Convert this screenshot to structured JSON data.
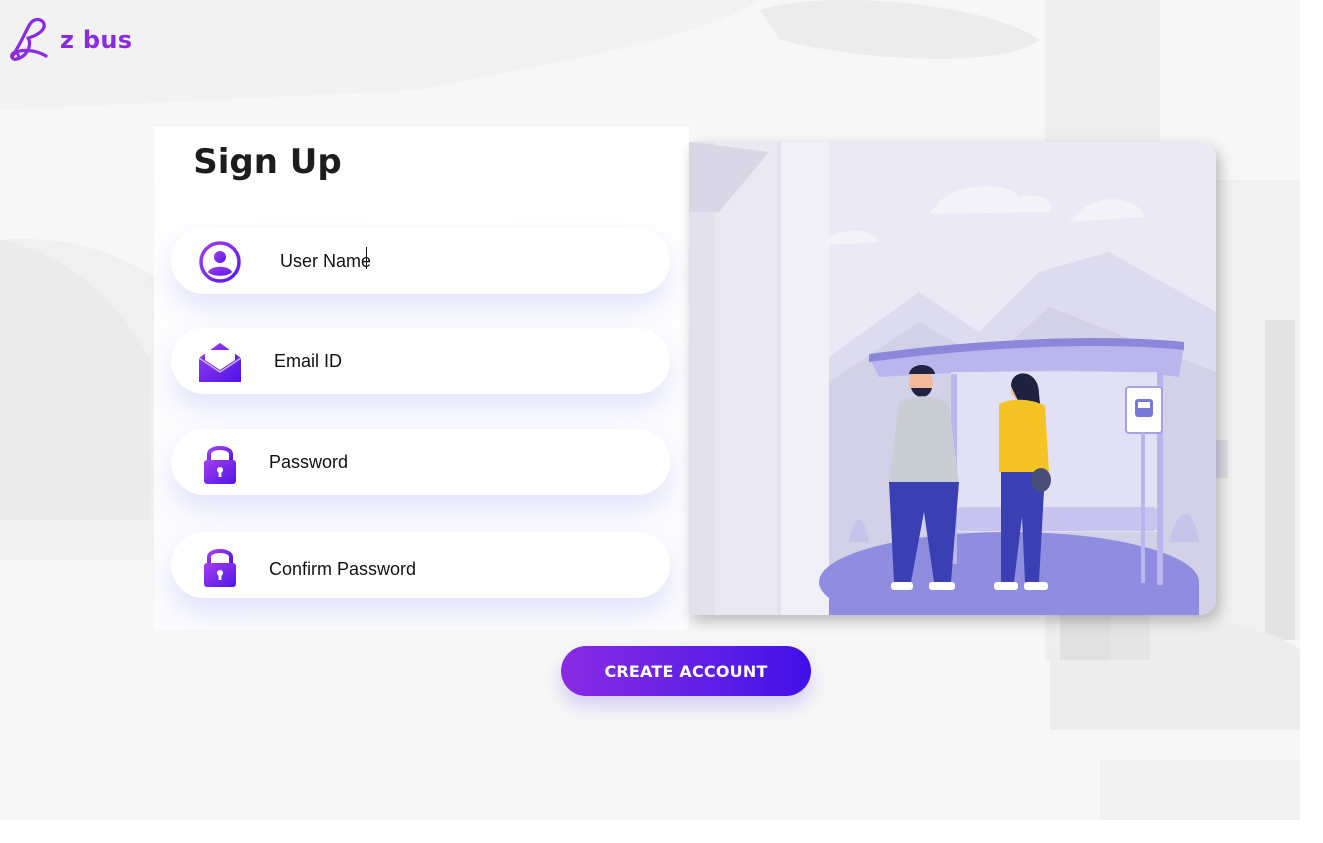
{
  "brand": {
    "name": "z bus",
    "accent": "#8a2be2"
  },
  "signup": {
    "title": "Sign Up",
    "fields": [
      {
        "icon": "user-circle-icon",
        "value": "User Name"
      },
      {
        "icon": "envelope-icon",
        "placeholder": "Email ID"
      },
      {
        "icon": "lock-icon",
        "placeholder": "Password"
      },
      {
        "icon": "lock-icon",
        "placeholder": "Confirm Password"
      }
    ],
    "submit_label": "CREATE ACCOUNT"
  },
  "illustration": {
    "sign_icon": "bus-icon"
  },
  "colors": {
    "primary": "#7b22e6",
    "primary_dark": "#3f0fe8",
    "illustration_bg": "#e9e7f6",
    "illustration_accent": "#8f8de0"
  }
}
